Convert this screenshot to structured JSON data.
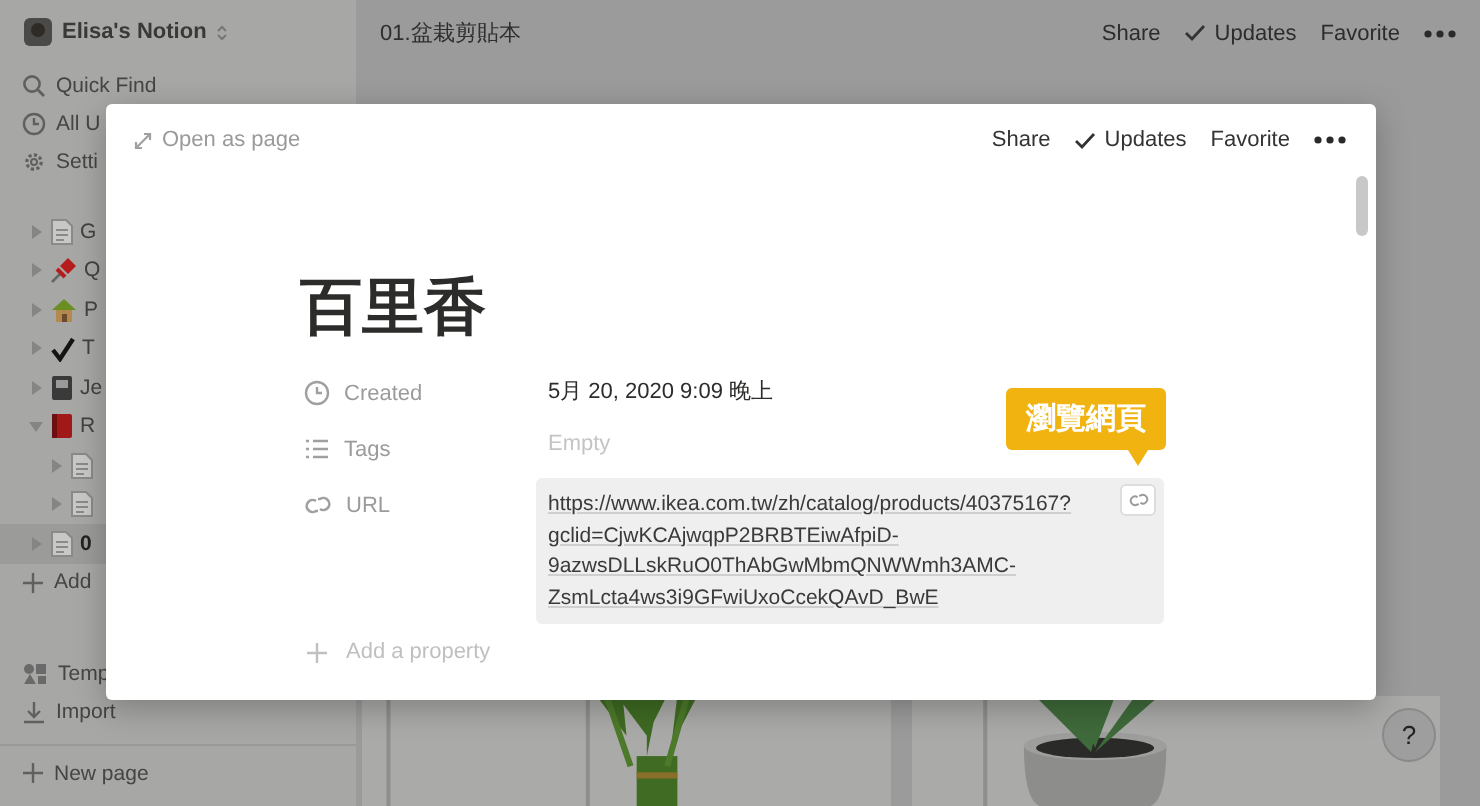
{
  "sidebar": {
    "workspace": "Elisa's Notion",
    "nav": [
      {
        "label": "Quick Find",
        "kind": "search"
      },
      {
        "label": "All U",
        "kind": "clock"
      },
      {
        "label": "Setti",
        "kind": "gear"
      }
    ],
    "pages": [
      {
        "label": "G",
        "kind": "doc",
        "expanded": false,
        "selected": false
      },
      {
        "label": "Q",
        "kind": "pin",
        "expanded": false,
        "selected": false
      },
      {
        "label": "P",
        "kind": "house",
        "expanded": false,
        "selected": false
      },
      {
        "label": "T",
        "kind": "check",
        "expanded": false,
        "selected": false
      },
      {
        "label": "Je",
        "kind": "book",
        "expanded": false,
        "selected": false
      },
      {
        "label": "R",
        "kind": "redbook",
        "expanded": true,
        "selected": false,
        "children": [
          {
            "kind": "doc",
            "expanded": false,
            "selected": false
          },
          {
            "kind": "doc",
            "expanded": false,
            "selected": false
          }
        ]
      },
      {
        "label": "0",
        "kind": "doc",
        "expanded": false,
        "selected": true
      }
    ],
    "add_page": "Add",
    "bottom": [
      {
        "label": "Temp",
        "kind": "templates"
      },
      {
        "label": "Import",
        "kind": "import"
      }
    ],
    "new_page": "New page"
  },
  "topbar": {
    "title": "01.盆栽剪貼本",
    "actions": [
      "Share",
      "Updates",
      "Favorite"
    ]
  },
  "modal": {
    "open_as_page": "Open as page",
    "actions": [
      "Share",
      "Updates",
      "Favorite"
    ],
    "title": "百里香",
    "properties": [
      {
        "kind": "clock",
        "label": "Created",
        "value": [
          "5月 20, 2020 9:09 晚上"
        ]
      },
      {
        "kind": "list",
        "label": "Tags",
        "placeholder": "Empty"
      },
      {
        "kind": "link",
        "label": "URL",
        "value": [
          "https://www.ikea.com.tw/zh/catalog/products/40375167?",
          "gclid=CjwKCAjwqpP2BRBTEiwAfpiD-",
          "9azwsDLLskRuO0ThAbGwMbmQNWWmh3AMC-",
          "ZsmLcta4ws3i9GFwiUxoCcekQAvD_BwE"
        ]
      }
    ],
    "add_property": "Add a property",
    "tooltip": "瀏覽網頁"
  },
  "help": "?"
}
